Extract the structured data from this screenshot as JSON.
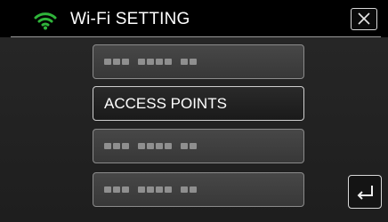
{
  "header": {
    "title": "Wi-Fi SETTING",
    "icon": "wifi-icon",
    "wifi_color": "#2fb43a",
    "close_icon": "close-icon"
  },
  "menu": {
    "items": [
      {
        "label": "",
        "state": "obscured"
      },
      {
        "label": "ACCESS POINTS",
        "state": "selected"
      },
      {
        "label": "",
        "state": "obscured"
      },
      {
        "label": "",
        "state": "obscured"
      }
    ]
  },
  "footer": {
    "back_icon": "return-icon"
  }
}
